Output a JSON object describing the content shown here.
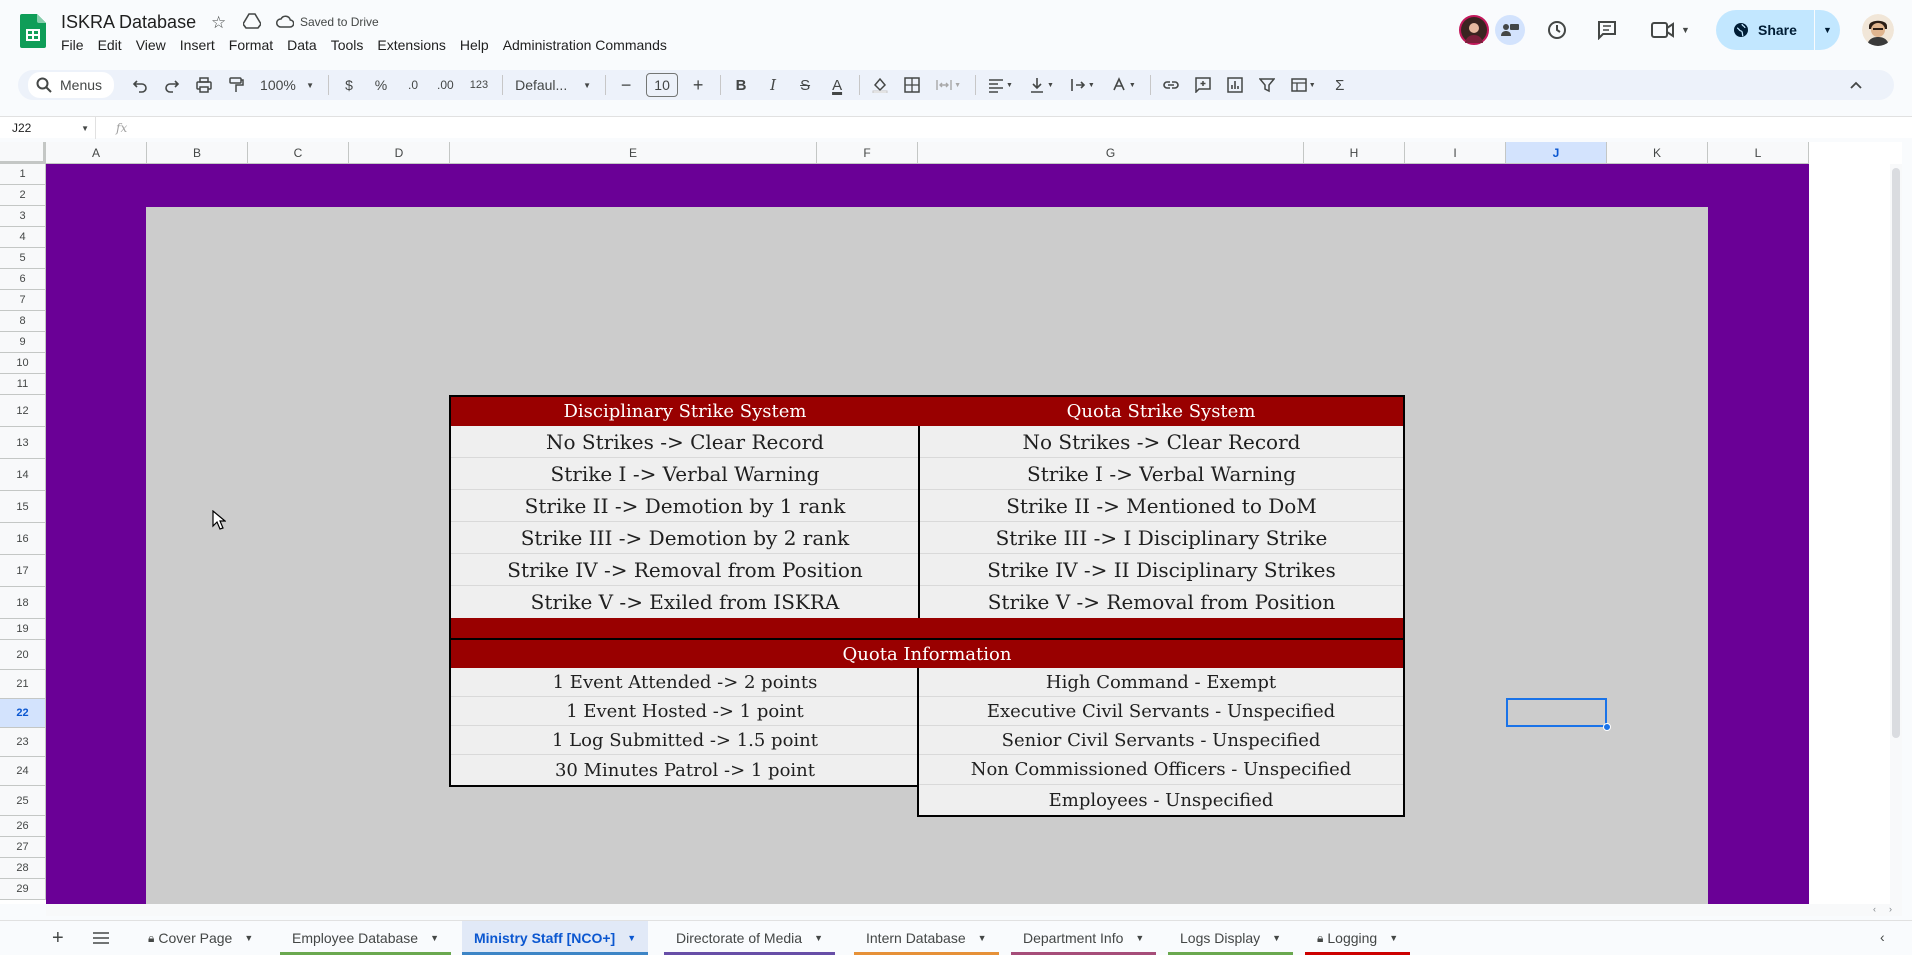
{
  "app": {
    "doc_title": "ISKRA Database",
    "save_status": "Saved to Drive",
    "menu": [
      "File",
      "Edit",
      "View",
      "Insert",
      "Format",
      "Data",
      "Tools",
      "Extensions",
      "Help",
      "Administration Commands"
    ],
    "share_label": "Share"
  },
  "toolbar": {
    "menus_label": "Menus",
    "zoom": "100%",
    "currency": "$",
    "percent": "%",
    "decrease_decimal": ".0",
    "increase_decimal": ".00",
    "number_format": "123",
    "font": "Defaul...",
    "font_size": "10",
    "bold": "B",
    "italic": "I",
    "strike": "S",
    "text_color": "A",
    "function": "Σ"
  },
  "formula_bar": {
    "cell_ref": "J22",
    "fx": "fx",
    "value": ""
  },
  "grid": {
    "columns": [
      "A",
      "B",
      "C",
      "D",
      "E",
      "F",
      "G",
      "H",
      "I",
      "J",
      "K",
      "L"
    ],
    "rows": [
      "1",
      "2",
      "3",
      "4",
      "5",
      "6",
      "7",
      "8",
      "9",
      "10",
      "11",
      "12",
      "13",
      "14",
      "15",
      "16",
      "17",
      "18",
      "19",
      "20",
      "21",
      "22",
      "23",
      "24",
      "25",
      "26",
      "27",
      "28",
      "29"
    ],
    "selected_column": "J",
    "selected_row": "22"
  },
  "sheet": {
    "disciplinary": {
      "header": "Disciplinary Strike System",
      "items": [
        "No Strikes -> Clear Record",
        "Strike I -> Verbal Warning",
        "Strike II -> Demotion by 1 rank",
        "Strike III -> Demotion by 2 rank",
        "Strike IV -> Removal from Position",
        "Strike V -> Exiled from ISKRA"
      ]
    },
    "quota_strike": {
      "header": "Quota Strike System",
      "items": [
        "No Strikes -> Clear Record",
        "Strike I -> Verbal Warning",
        "Strike II -> Mentioned to DoM",
        "Strike III -> I Disciplinary Strike",
        "Strike IV -> II Disciplinary Strikes",
        "Strike V -> Removal from Position"
      ]
    },
    "quota_info": {
      "header": "Quota Information",
      "points": [
        "1 Event Attended -> 2 points",
        "1 Event Hosted -> 1 point",
        "1 Log Submitted -> 1.5 point",
        "30 Minutes Patrol -> 1 point"
      ],
      "requirements": [
        "High Command - Exempt",
        "Executive Civil Servants - Unspecified",
        "Senior Civil Servants - Unspecified",
        "Non Commissioned Officers - Unspecified",
        "Employees - Unspecified"
      ]
    }
  },
  "tabs": [
    {
      "label": "Cover Page",
      "locked": true,
      "color": ""
    },
    {
      "label": "Employee Database",
      "locked": false,
      "color": "#6aa84f"
    },
    {
      "label": "Ministry Staff [NCO+]",
      "locked": false,
      "color": "#3d85c6",
      "active": true
    },
    {
      "label": "Directorate of Media",
      "locked": false,
      "color": "#674ea7"
    },
    {
      "label": "Intern Database",
      "locked": false,
      "color": "#e69138"
    },
    {
      "label": "Department Info",
      "locked": false,
      "color": "#a64d79"
    },
    {
      "label": "Logs Display",
      "locked": false,
      "color": "#6aa84f"
    },
    {
      "label": "Logging",
      "locked": true,
      "color": "#cc0000"
    }
  ],
  "colors": {
    "sheet_bg": "#6a0096",
    "panel_bg": "#cccccc",
    "header_bg": "#990000",
    "accent": "#0b57d0"
  }
}
